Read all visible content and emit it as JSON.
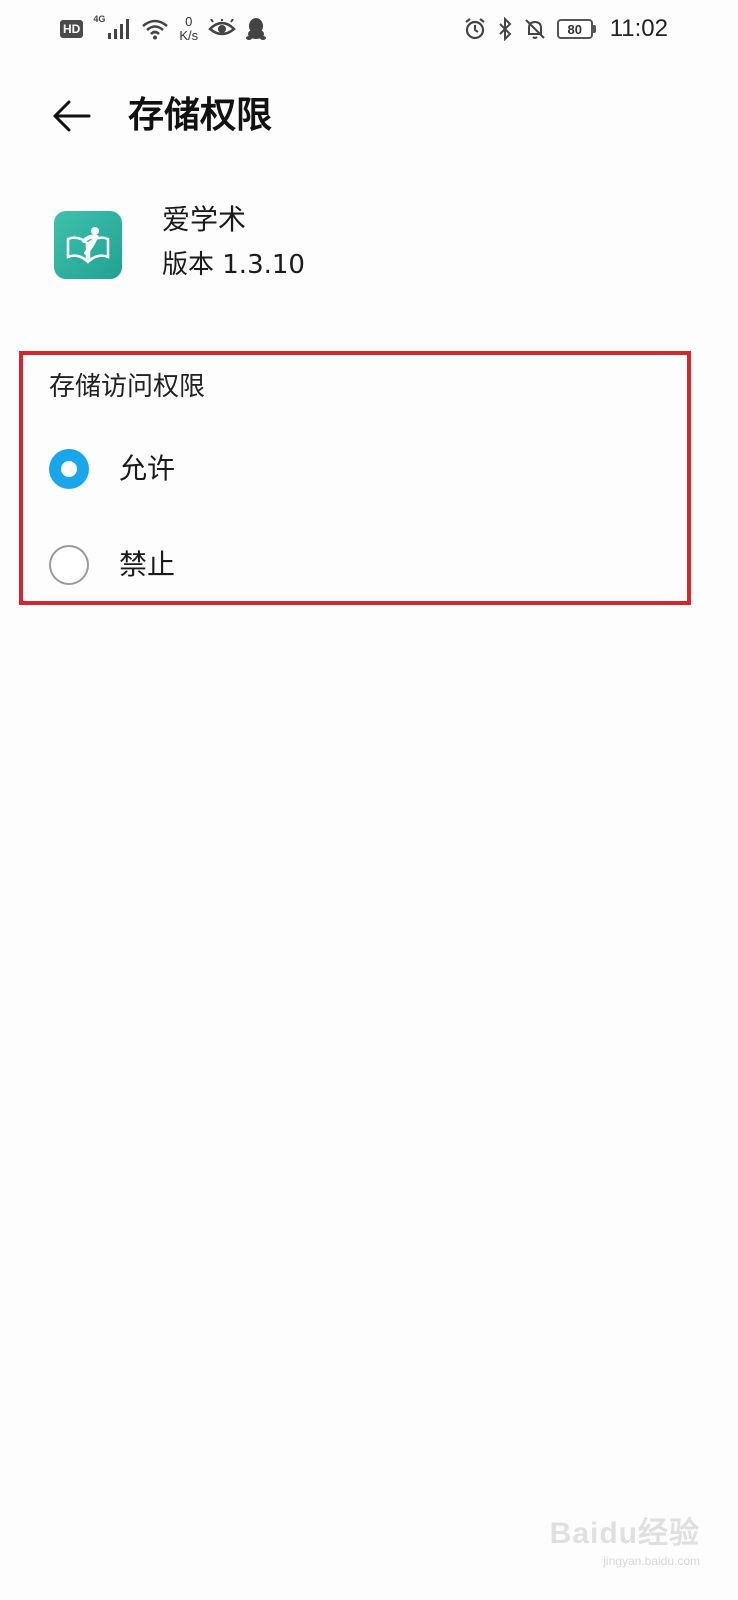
{
  "status_bar": {
    "hd_label": "HD",
    "network_type": "4G",
    "speed_value": "0",
    "speed_unit": "K/s",
    "battery_level": "80",
    "time": "11:02",
    "icons_left": [
      "hd-icon",
      "signal-icon",
      "wifi-icon",
      "eye-icon",
      "qq-penguin-icon"
    ],
    "icons_right": [
      "alarm-icon",
      "bluetooth-icon",
      "bell-off-icon",
      "battery-icon"
    ]
  },
  "header": {
    "back_icon": "arrow-left-icon",
    "title": "存储权限"
  },
  "app": {
    "name": "爱学术",
    "version": "版本 1.3.10",
    "icon_color": "#2bb09f"
  },
  "permission": {
    "heading": "存储访问权限",
    "options": [
      {
        "label": "允许",
        "selected": true
      },
      {
        "label": "禁止",
        "selected": false
      }
    ],
    "accent_color": "#1aa6ea",
    "highlight_border_color": "#d3262e"
  },
  "watermark": {
    "logo": "Baidu经验",
    "site": "jingyan.baidu.com"
  }
}
